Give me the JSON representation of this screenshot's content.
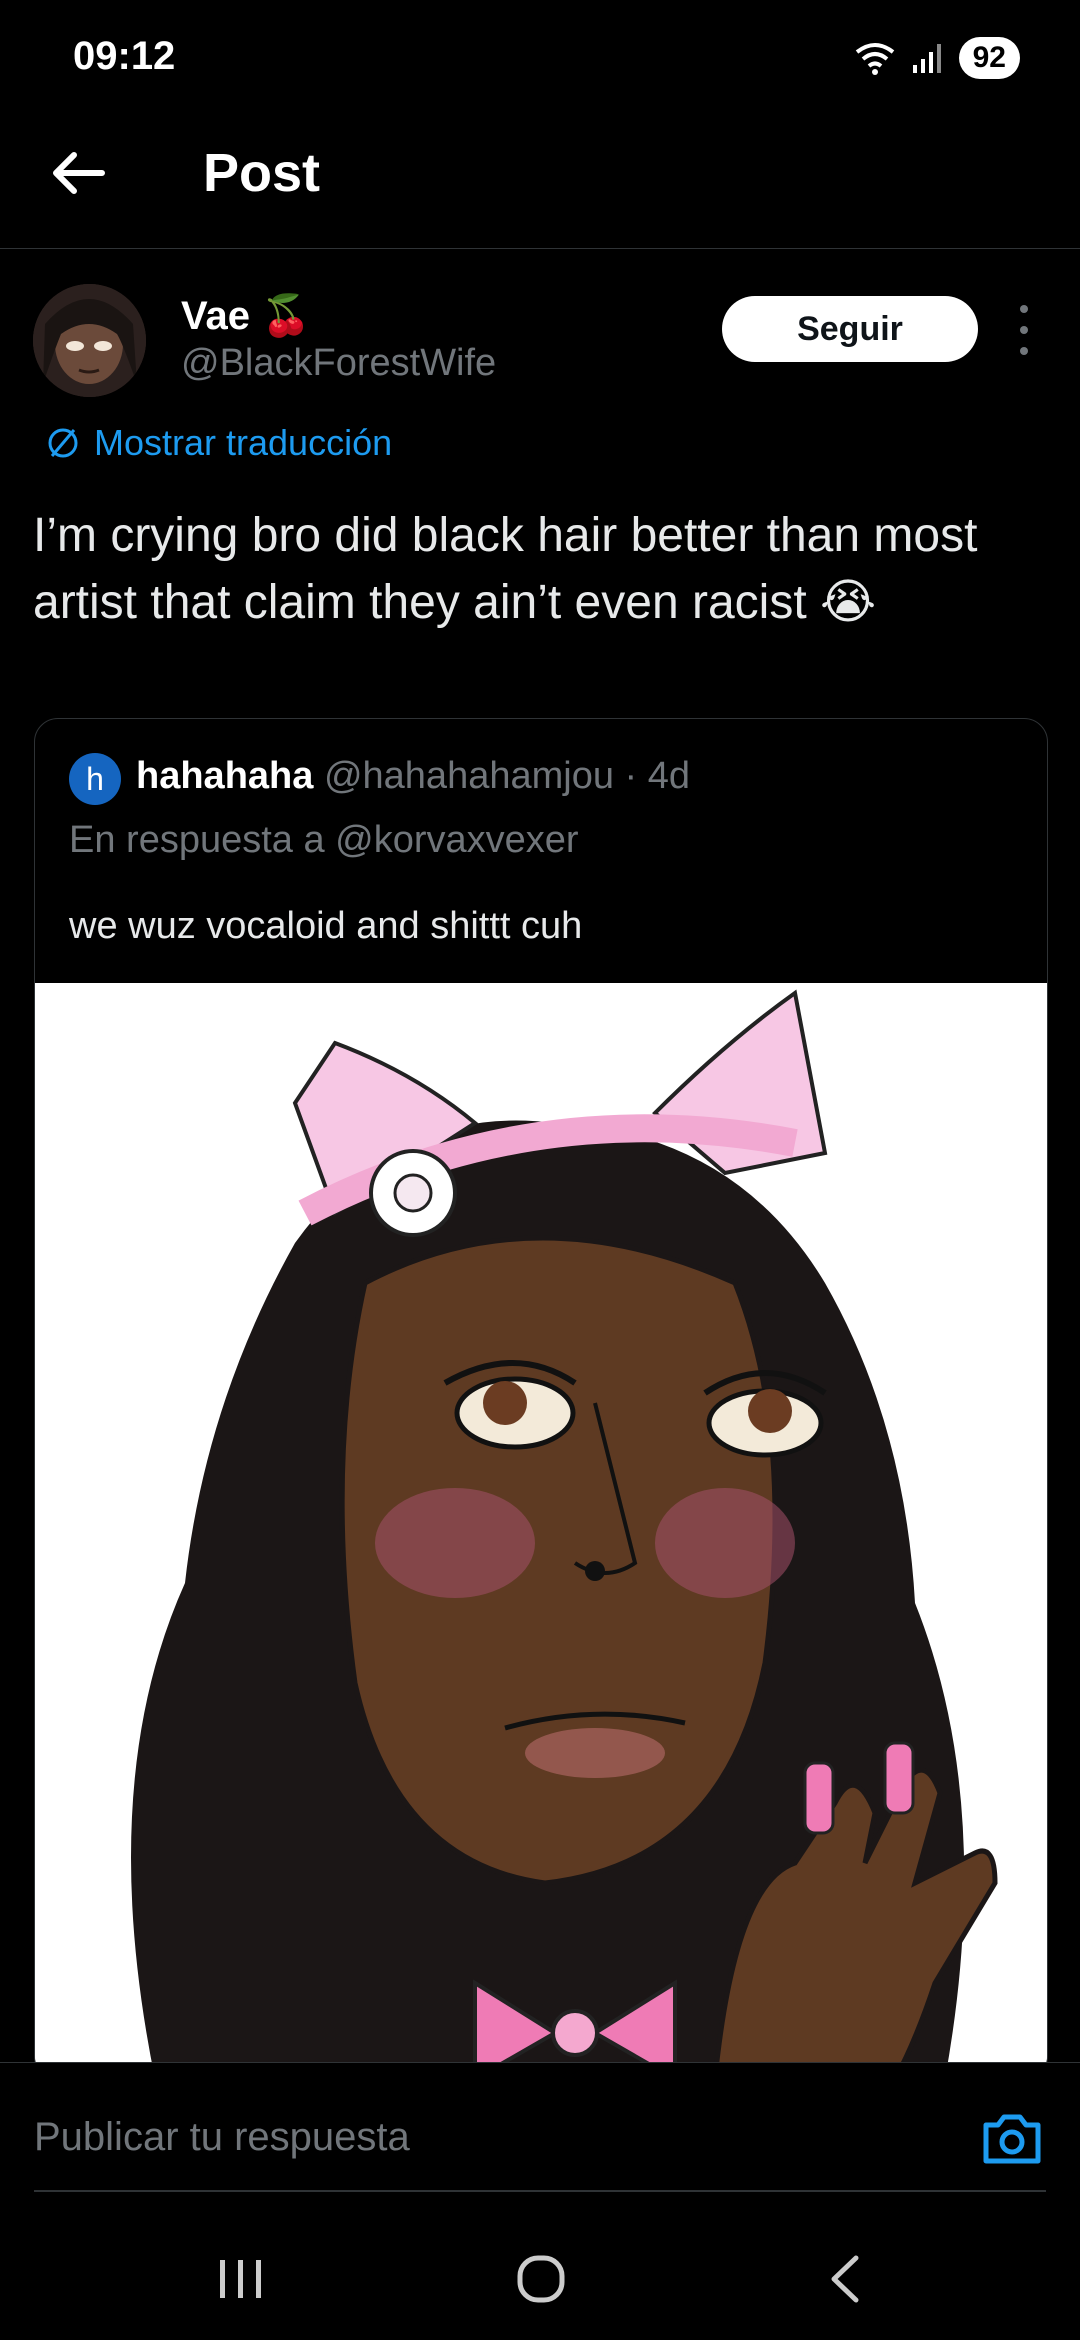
{
  "status_bar": {
    "time": "09:12",
    "battery": "92"
  },
  "header": {
    "title": "Post"
  },
  "post": {
    "author_name": "Vae",
    "author_emoji": "🍒",
    "author_handle": "@BlackForestWife",
    "follow_label": "Seguir",
    "translate_label": "Mostrar traducción",
    "text": "I’m crying bro did black hair better than most artist that claim they ain’t even racist 😭"
  },
  "quote": {
    "avatar_letter": "h",
    "name": "hahahaha",
    "handle": "@hahahahamjou",
    "time": "· 4d",
    "reply_to": "En respuesta a @korvaxvexer",
    "text": "we wuz vocaloid and shittt cuh"
  },
  "reply": {
    "placeholder": "Publicar tu respuesta"
  },
  "colors": {
    "accent": "#1d9bf0",
    "background": "#000000",
    "secondary_text": "#71767b"
  }
}
